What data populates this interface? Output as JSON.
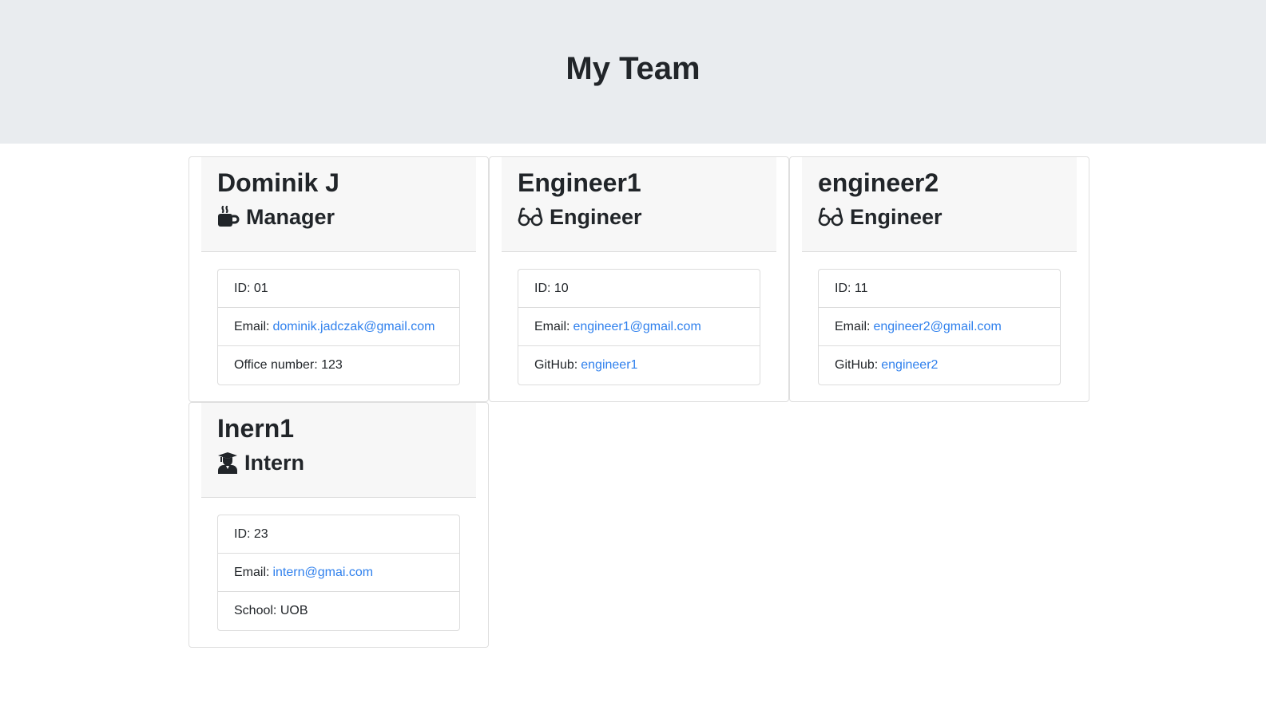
{
  "header": {
    "title": "My Team"
  },
  "colors": {
    "header_bg": "#e9ecef",
    "link": "#2f80ed",
    "card_header_bg": "#f7f7f7"
  },
  "employees": [
    {
      "name": "Dominik J",
      "role": "Manager",
      "icon": "coffee-icon",
      "id_text": "ID: 01",
      "email_label": "Email:",
      "email": "dominik.jadczak@gmail.com",
      "extra_label": "Office number: 123",
      "extra_value": ""
    },
    {
      "name": "Engineer1",
      "role": "Engineer",
      "icon": "glasses-icon",
      "id_text": "ID: 10",
      "email_label": "Email:",
      "email": "engineer1@gmail.com",
      "extra_label": "GitHub:",
      "extra_value": "engineer1"
    },
    {
      "name": "engineer2",
      "role": "Engineer",
      "icon": "glasses-icon",
      "id_text": "ID: 11",
      "email_label": "Email:",
      "email": "engineer2@gmail.com",
      "extra_label": "GitHub:",
      "extra_value": "engineer2"
    },
    {
      "name": "Inern1",
      "role": "Intern",
      "icon": "graduate-icon",
      "id_text": "ID: 23",
      "email_label": "Email:",
      "email": "intern@gmai.com",
      "extra_label": "School: UOB",
      "extra_value": ""
    }
  ]
}
